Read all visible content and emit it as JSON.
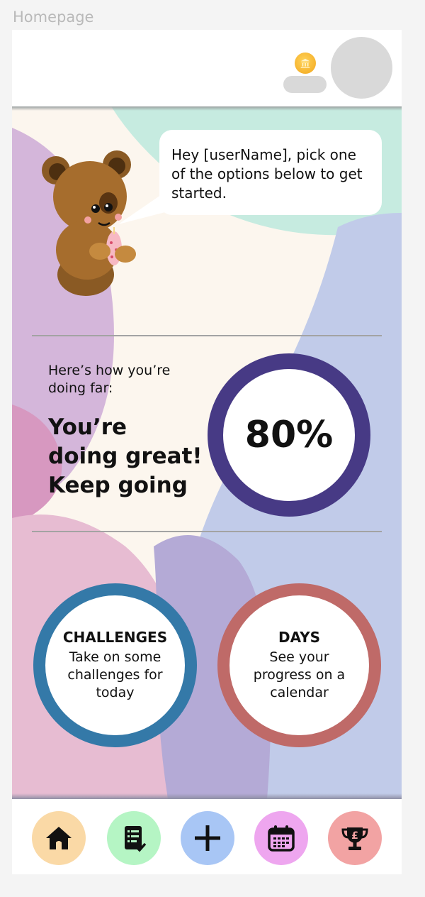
{
  "frame_label": "Homepage",
  "header": {
    "coin_icon": "bank-coin-icon",
    "avatar_icon": "avatar"
  },
  "mascot": {
    "speech": "Hey [userName], pick one of the options below to get started."
  },
  "progress": {
    "intro": "Here’s how you’re doing far:",
    "message": "You’re doing great! Keep going",
    "value_text": "80%",
    "value": 0.8,
    "ring_color": "#473a85"
  },
  "cards": {
    "challenges": {
      "title": "CHALLENGES",
      "description": "Take on some challenges for today",
      "color": "#3479a8"
    },
    "days": {
      "title": "DAYS",
      "description": "See your progress on a calendar",
      "color": "#bf6a68"
    }
  },
  "nav": [
    {
      "icon": "home-icon",
      "color": "#fad9a6"
    },
    {
      "icon": "checklist-icon",
      "color": "#b5f5c4"
    },
    {
      "icon": "plus-icon",
      "color": "#a8c6f5"
    },
    {
      "icon": "calendar-icon",
      "color": "#eea6ef"
    },
    {
      "icon": "trophy-pound-icon",
      "color": "#f2a3a3"
    }
  ]
}
